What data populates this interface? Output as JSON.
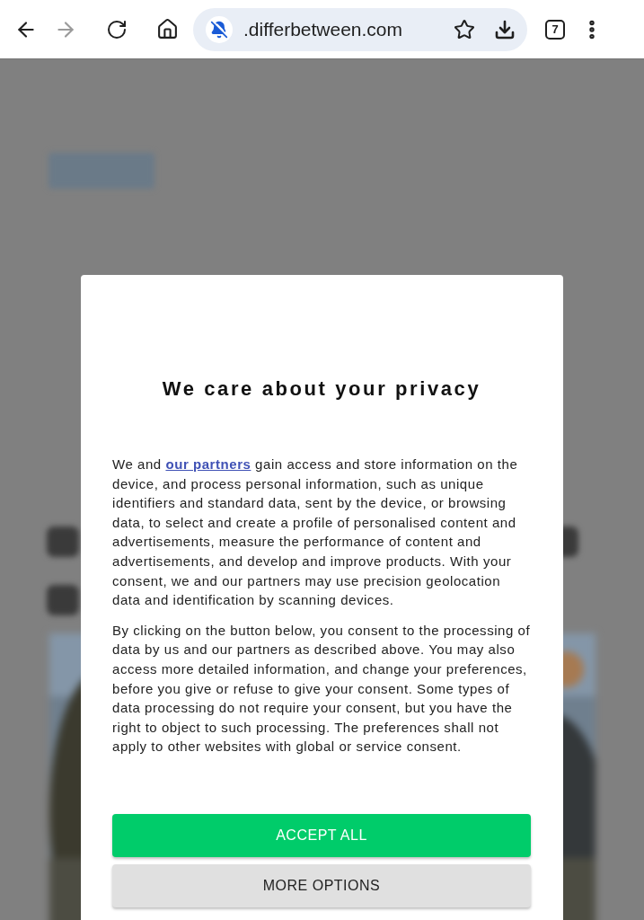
{
  "toolbar": {
    "back": {
      "disabled": false
    },
    "forward": {
      "disabled": true
    },
    "url": ".differbetween.com",
    "tab_count": "7"
  },
  "page": {
    "blurred": true
  },
  "dialog": {
    "title": "We care about your privacy",
    "paragraphs": [
      {
        "kind": "link",
        "before": "We and ",
        "link": "our partners",
        "after": " gain access and store information on the device, and process personal information, such as unique identifiers and standard data, sent by the device, or browsing data, to select and create a profile of personalised content and advertisements, measure the performance of content and advertisements, and develop and improve products. With your consent, we and our partners may use precision geolocation data and identification by scanning devices."
      },
      {
        "kind": "plain",
        "text": "By clicking on the button below, you consent to the processing of data by us and our partners as described above. You may also access more detailed information, and change your preferences, before you give or refuse to give your consent. Some types of data processing do not require your consent, but you have the right to object to such processing. The preferences shall not apply to other websites with global or service consent."
      }
    ],
    "buttons": [
      {
        "kind": "primary",
        "label": "ACCEPT ALL"
      },
      {
        "kind": "secondary",
        "label": "MORE OPTIONS"
      }
    ]
  }
}
